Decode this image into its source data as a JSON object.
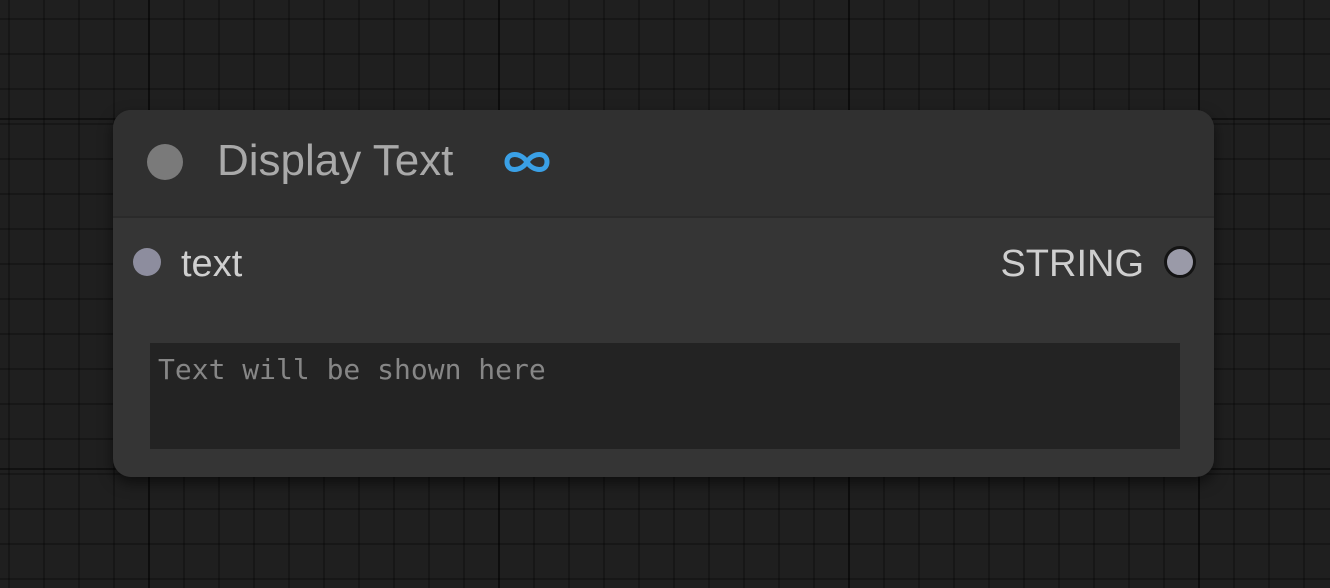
{
  "node": {
    "title": "Display Text",
    "title_icon": "link-infinity-icon",
    "accent_color": "#3aa0e6",
    "input": {
      "label": "text"
    },
    "output": {
      "label": "STRING"
    },
    "textarea": {
      "value": "",
      "placeholder": "Text will be shown here"
    }
  }
}
